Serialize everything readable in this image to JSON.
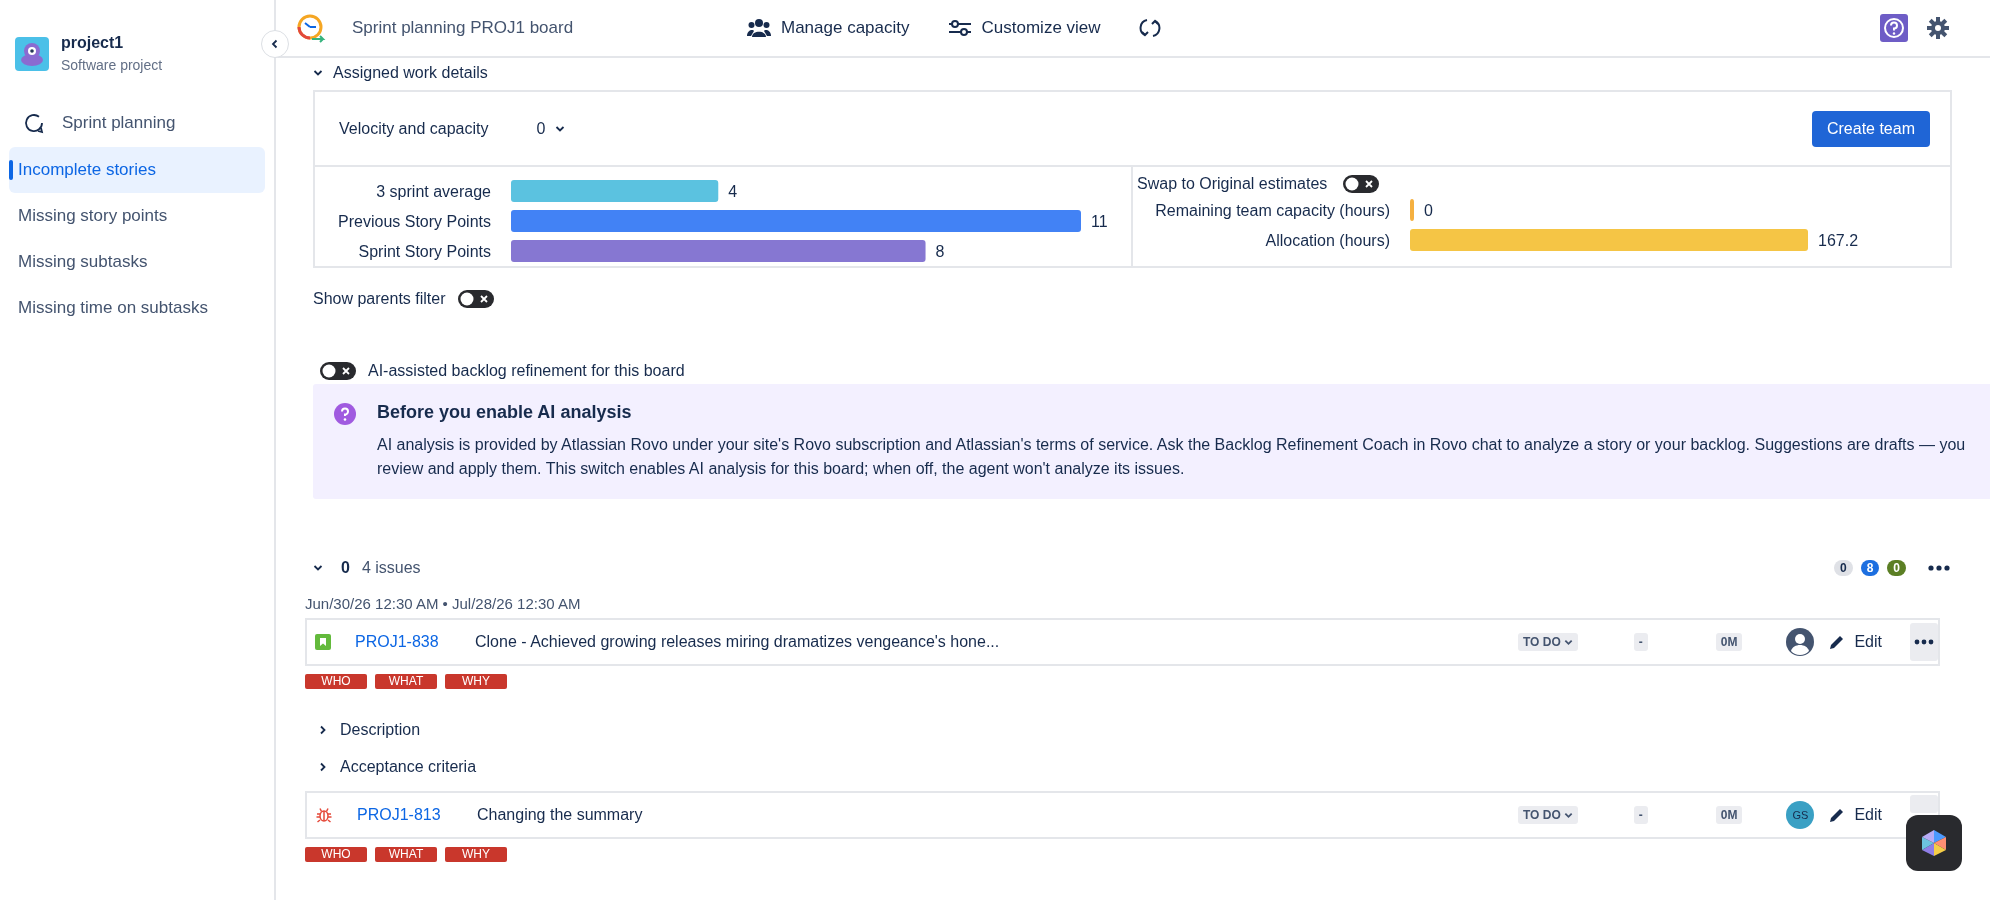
{
  "sidebar": {
    "project": {
      "name": "project1",
      "type": "Software project"
    },
    "title": "Sprint planning",
    "items": [
      {
        "label": "Incomplete stories",
        "selected": true
      },
      {
        "label": "Missing story points",
        "selected": false
      },
      {
        "label": "Missing subtasks",
        "selected": false
      },
      {
        "label": "Missing time on subtasks",
        "selected": false
      }
    ]
  },
  "header": {
    "title": "Sprint planning PROJ1 board",
    "actions": [
      {
        "label": "Manage capacity",
        "kind": "people"
      },
      {
        "label": "Customize view",
        "kind": "sliders"
      }
    ]
  },
  "assigned_work": {
    "title": "Assigned work details",
    "expanded": true,
    "velocity_label": "Velocity and capacity",
    "velocity_value": "0",
    "create_button": "Create team",
    "points_chart": {
      "chart_data": {
        "type": "bar",
        "orientation": "horizontal",
        "data_labels": true,
        "categories": [
          "3 sprint average",
          "Previous Story Points",
          "Sprint Story Points"
        ],
        "values": [
          4,
          11,
          8
        ],
        "colors": [
          "#5bc2e0",
          "#4282f5",
          "#8677d2"
        ]
      }
    },
    "swap": {
      "label": "Swap to Original estimates",
      "on": false
    },
    "capacity_chart": {
      "chart_data": {
        "type": "bar",
        "orientation": "horizontal",
        "data_labels": true,
        "categories": [
          "Remaining team capacity (hours)",
          "Allocation (hours)"
        ],
        "values": [
          0,
          167.2
        ],
        "colors": [
          "#f5b040",
          "#f5c545"
        ]
      }
    }
  },
  "show_parents": {
    "label": "Show parents filter",
    "on": false
  },
  "ai": {
    "label": "AI-assisted backlog refinement for this board",
    "on": false,
    "notice": {
      "title": "Before you enable AI analysis",
      "text": "AI analysis is provided by Atlassian Rovo under your site's Rovo subscription and Atlassian's terms of service. Ask the Backlog Refinement Coach in Rovo chat to analyze a story or your backlog. Suggestions are drafts — you review and apply them. This switch enables AI analysis for this board; when off, the agent won't analyze its issues."
    }
  },
  "sprint": {
    "expanded": true,
    "name": "0",
    "count": "4 issues",
    "badges": [
      {
        "text": "0",
        "color": "#dfe1e6"
      },
      {
        "text": "8",
        "color": "#1d6fe0"
      },
      {
        "text": "0",
        "color": "#5b7f24"
      }
    ],
    "dates": "Jun/30/26 12:30 AM • Jul/28/26 12:30 AM",
    "issues": [
      {
        "kind": "story",
        "key": "PROJ1-838",
        "summary": "Clone - Achieved growing releases miring dramatizes vengeance's hone...",
        "status": "TO DO",
        "points": "-",
        "time": "0M",
        "edit": "Edit",
        "tags": [
          "WHO",
          "WHAT",
          "WHY"
        ],
        "sections": [
          {
            "label": "Description",
            "expanded": false
          },
          {
            "label": "Acceptance criteria",
            "expanded": false
          }
        ]
      },
      {
        "kind": "bug",
        "key": "PROJ1-813",
        "summary": "Changing the summary",
        "status": "TO DO",
        "points": "-",
        "time": "0M",
        "assignee_initials": "GS",
        "edit": "Edit",
        "tags": [
          "WHO",
          "WHAT",
          "WHY"
        ]
      }
    ]
  }
}
